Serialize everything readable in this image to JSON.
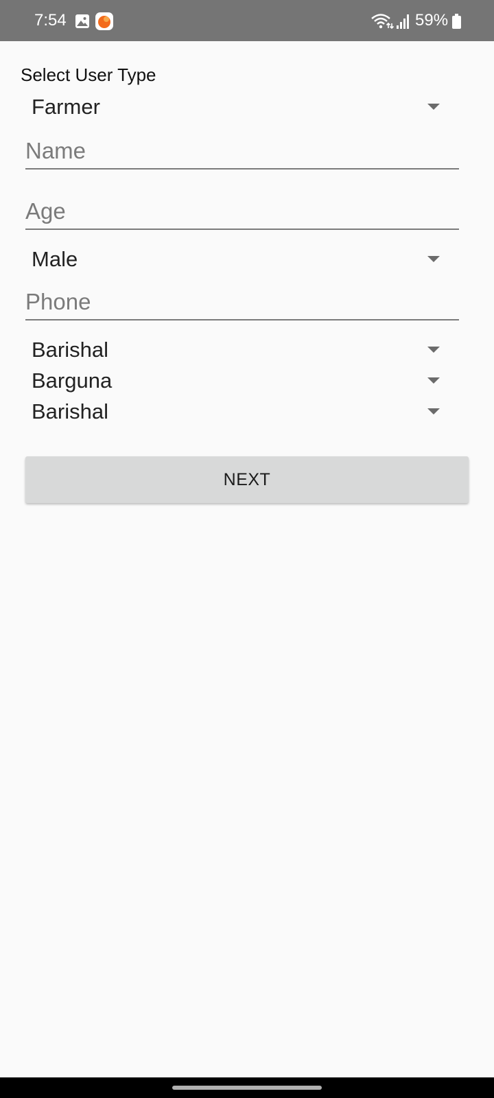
{
  "status_bar": {
    "time": "7:54",
    "battery": "59%",
    "icons": [
      "gallery-icon",
      "app-notification-icon",
      "wifi-icon",
      "signal-icon",
      "battery-icon"
    ]
  },
  "form": {
    "user_type_label": "Select User Type",
    "user_type_value": "Farmer",
    "name_placeholder": "Name",
    "age_placeholder": "Age",
    "gender_value": "Male",
    "phone_placeholder": "Phone",
    "division_value": "Barishal",
    "district_value": "Barguna",
    "upazila_value": "Barishal",
    "next_label": "NEXT"
  },
  "colors": {
    "status_bar": "#757575",
    "background": "#fafafa",
    "button": "#d8d9d9",
    "nav_bar": "#000000"
  }
}
